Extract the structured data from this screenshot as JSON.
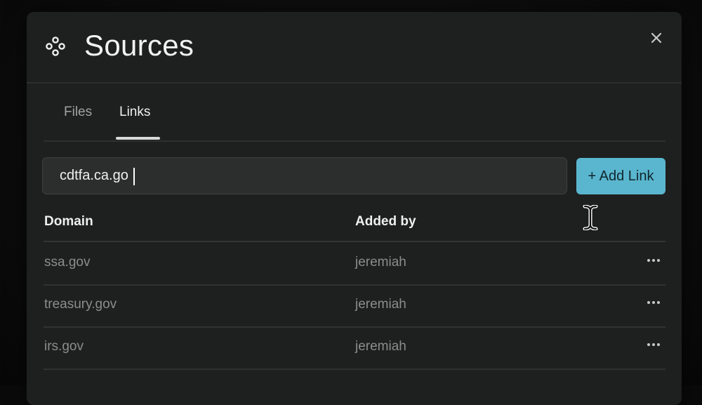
{
  "modal": {
    "title": "Sources",
    "header_icon": "dots-cluster-icon",
    "close_icon": "close-icon"
  },
  "tabs": [
    {
      "label": "Files",
      "active": false
    },
    {
      "label": "Links",
      "active": true
    }
  ],
  "link_input": {
    "value": "cdtfa.ca.go",
    "placeholder": ""
  },
  "add_link_button": {
    "label": "+ Add Link",
    "color": "#5ab6cf"
  },
  "table": {
    "columns": [
      "Domain",
      "Added by"
    ],
    "rows": [
      {
        "domain": "ssa.gov",
        "added_by": "jeremiah"
      },
      {
        "domain": "treasury.gov",
        "added_by": "jeremiah"
      },
      {
        "domain": "irs.gov",
        "added_by": "jeremiah"
      }
    ],
    "row_action_icon": "more-horizontal-icon"
  },
  "colors": {
    "background": "#0a0a0a",
    "modal": "#1e1f1f",
    "accent": "#5ab6cf"
  }
}
